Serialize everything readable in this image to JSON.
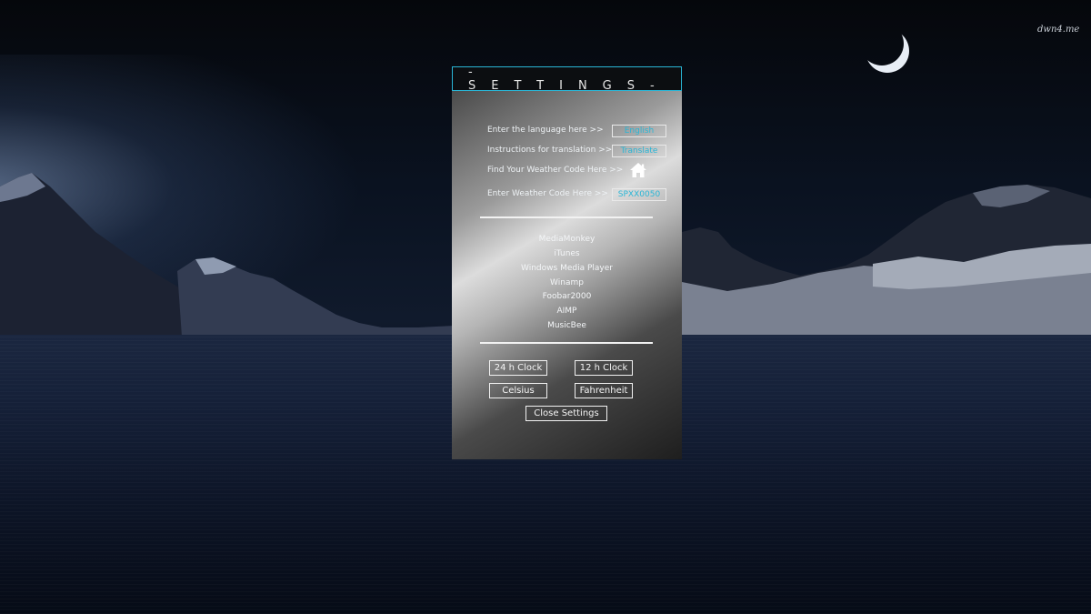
{
  "watermark": "dwn4.me",
  "settings": {
    "title": "-SETTINGS-",
    "language_label": "Enter the language here  >>",
    "language_value": "English",
    "translation_label": "Instructions for translation  >>",
    "translation_value": "Translate",
    "weather_find_label": "Find Your Weather Code Here  >>",
    "weather_code_label": "Enter Weather Code Here >>",
    "weather_code_value": "SPXX0050",
    "players": [
      "MediaMonkey",
      "iTunes",
      "Windows Media Player",
      "Winamp",
      "Foobar2000",
      "AIMP",
      "MusicBee"
    ],
    "buttons": {
      "clock24": "24 h Clock",
      "clock12": "12 h Clock",
      "celsius": "Celsius",
      "fahrenheit": "Fahrenheit",
      "close": "Close Settings"
    }
  },
  "icons": {
    "weather_link": "home-icon"
  },
  "colors": {
    "accent": "#29b6d6",
    "header_bg": "#0c0e11",
    "text": "#eef2f5"
  }
}
